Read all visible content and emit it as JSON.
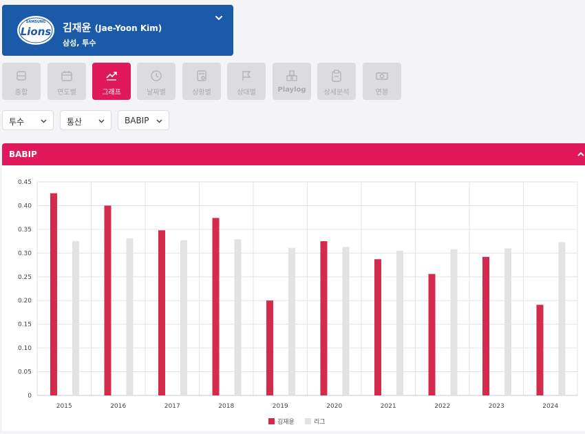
{
  "player": {
    "name_kr": "김재윤",
    "name_en": "(Jae-Yoon Kim)",
    "subtitle": "삼성, 투수",
    "logo_text": "Lions",
    "logo_top_text": "SAMSUNG",
    "brand_color": "#1a5aa8"
  },
  "tabs": [
    {
      "label": "종합",
      "icon": "database-icon",
      "active": false
    },
    {
      "label": "연도별",
      "icon": "calendar-icon",
      "active": false
    },
    {
      "label": "그래프",
      "icon": "line-chart-icon",
      "active": true
    },
    {
      "label": "날짜별",
      "icon": "clock-calendar-icon",
      "active": false
    },
    {
      "label": "상황별",
      "icon": "situation-icon",
      "active": false
    },
    {
      "label": "상대별",
      "icon": "flag-icon",
      "active": false
    },
    {
      "label": "Playlog",
      "icon": "blocks-icon",
      "active": false
    },
    {
      "label": "상세분석",
      "icon": "clipboard-icon",
      "active": false
    },
    {
      "label": "연봉",
      "icon": "money-icon",
      "active": false
    }
  ],
  "filters": {
    "position": "투수",
    "period": "통산",
    "stat": "BABIP"
  },
  "panel": {
    "title": "BABIP"
  },
  "colors": {
    "accent": "#e0195b",
    "player_bar": "#d42a4c",
    "league_bar": "#e3e3e3"
  },
  "chart_data": {
    "type": "bar",
    "categories": [
      "2015",
      "2016",
      "2017",
      "2018",
      "2019",
      "2020",
      "2021",
      "2022",
      "2023",
      "2024"
    ],
    "series": [
      {
        "name": "김재윤",
        "values": [
          0.426,
          0.4,
          0.348,
          0.374,
          0.2,
          0.325,
          0.287,
          0.256,
          0.292,
          0.191
        ]
      },
      {
        "name": "리그",
        "values": [
          0.325,
          0.331,
          0.327,
          0.329,
          0.311,
          0.313,
          0.305,
          0.308,
          0.31,
          0.323
        ]
      }
    ],
    "yticks": [
      "0",
      "0.05",
      "0.10",
      "0.15",
      "0.20",
      "0.25",
      "0.30",
      "0.35",
      "0.40",
      "0.45"
    ],
    "ylim": [
      0,
      0.45
    ],
    "grid": true,
    "legend": "bottom-center"
  }
}
